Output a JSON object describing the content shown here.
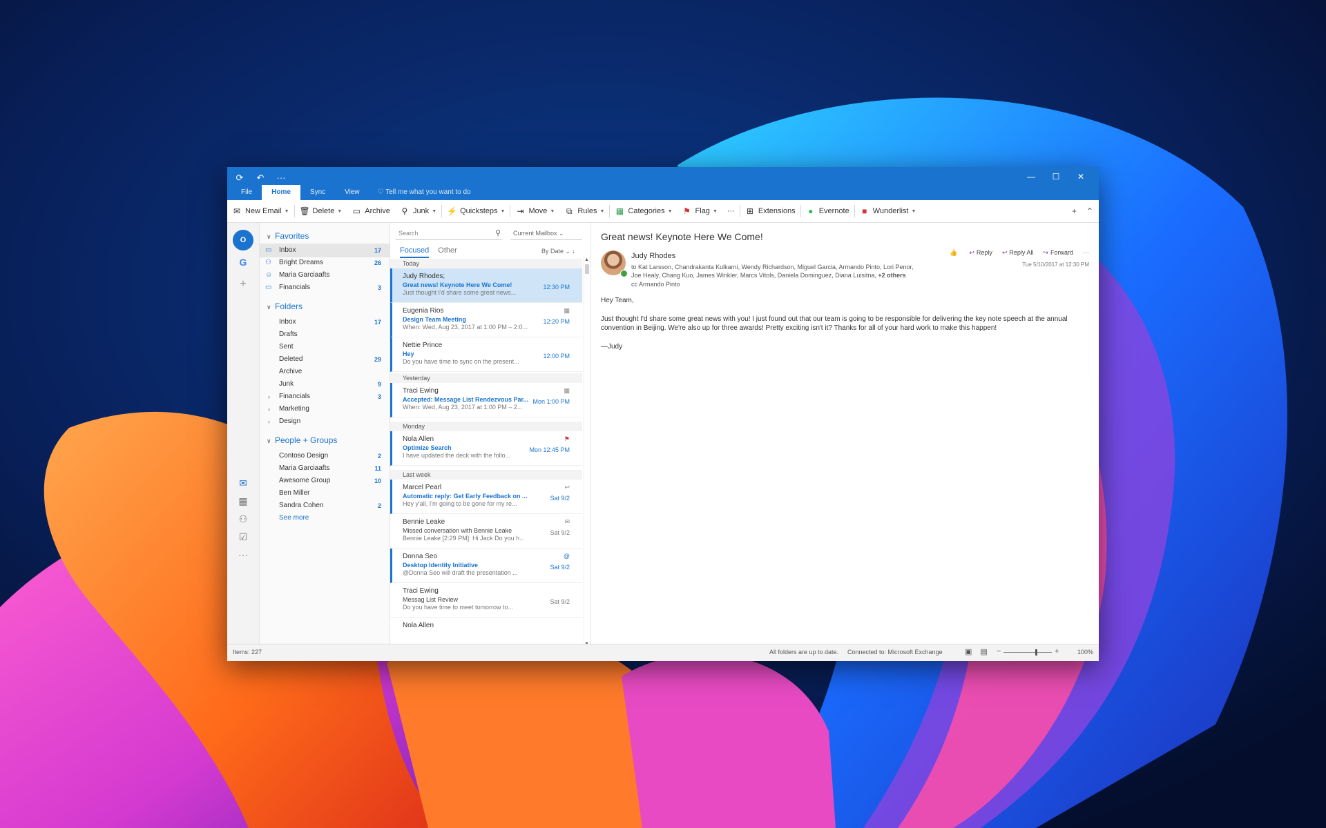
{
  "titlebar": {
    "icons": [
      "sync-icon",
      "undo-icon",
      "more-icon"
    ],
    "minimize": "—",
    "maximize": "☐",
    "close": "✕"
  },
  "tabs": [
    {
      "label": "File"
    },
    {
      "label": "Home"
    },
    {
      "label": "Sync"
    },
    {
      "label": "View"
    }
  ],
  "tellme": "Tell me what you want to do",
  "ribbon": {
    "new_email": "New Email",
    "delete": "Delete",
    "archive": "Archive",
    "junk": "Junk",
    "quicksteps": "Quicksteps",
    "move": "Move",
    "rules": "Rules",
    "categories": "Categories",
    "flag": "Flag",
    "more": "···",
    "extensions": "Extensions",
    "evernote": "Evernote",
    "wunderlist": "Wunderlist"
  },
  "favorites": {
    "title": "Favorites",
    "items": [
      {
        "label": "Inbox",
        "count": "17"
      },
      {
        "label": "Bright Dreams",
        "count": "26"
      },
      {
        "label": "Maria Garciaafts",
        "count": ""
      },
      {
        "label": "Financials",
        "count": "3"
      }
    ]
  },
  "folders": {
    "title": "Folders",
    "items": [
      {
        "label": "Inbox",
        "count": "17"
      },
      {
        "label": "Drafts",
        "count": ""
      },
      {
        "label": "Sent",
        "count": ""
      },
      {
        "label": "Deleted",
        "count": "29"
      },
      {
        "label": "Archive",
        "count": ""
      },
      {
        "label": "Junk",
        "count": "9"
      },
      {
        "label": "Financials",
        "count": "3"
      },
      {
        "label": "Marketing",
        "count": ""
      },
      {
        "label": "Design",
        "count": ""
      }
    ]
  },
  "people_groups": {
    "title": "People + Groups",
    "items": [
      {
        "label": "Contoso Design",
        "count": "2"
      },
      {
        "label": "Maria Garciaafts",
        "count": "11"
      },
      {
        "label": "Awesome Group",
        "count": "10"
      },
      {
        "label": "Ben Miller",
        "count": ""
      },
      {
        "label": "Sandra Cohen",
        "count": "2"
      }
    ],
    "see_more": "See more"
  },
  "msglist": {
    "search_placeholder": "Search",
    "mailbox": "Current Mailbox",
    "focused": "Focused",
    "other": "Other",
    "sort": "By Date",
    "groups": [
      "Today",
      "Yesterday",
      "Monday",
      "Last week"
    ],
    "messages": [
      {
        "from": "Judy Rhodes;",
        "subject": "Great news! Keynote Here We Come!",
        "preview": "Just thought I'd share some great news...",
        "time": "12:30 PM"
      },
      {
        "from": "Eugenia Rios",
        "subject": "Design Team Meeting",
        "preview": "When: Wed, Aug 23, 2017 at 1:00 PM – 2:0...",
        "time": "12:20 PM"
      },
      {
        "from": "Nettie Prince",
        "subject": "Hey",
        "preview": "Do you have time to sync on the present...",
        "time": "12:00 PM"
      },
      {
        "from": "Traci Ewing",
        "subject": "Accepted: Message List Rendezvous Par...",
        "preview": "When: Wed, Aug 23, 2017 at 1:00 PM – 2...",
        "time": "Mon 1:00 PM"
      },
      {
        "from": "Nola Allen",
        "subject": "Optimize Search",
        "preview": "I have updated the deck with the follo...",
        "time": "Mon 12:45 PM"
      },
      {
        "from": "Marcel Pearl",
        "subject": "Automatic reply: Get Early Feedback on ...",
        "preview": "Hey y'all, I'm going to be gone for my re...",
        "time": "Sat 9/2"
      },
      {
        "from": "Bennie Leake",
        "subject": "Missed conversation with Bennie Leake",
        "preview": "Bennie Leake [2:29 PM]: Hi Jack Do you h...",
        "time": "Sat 9/2"
      },
      {
        "from": "Donna Seo",
        "subject": "Desktop Identity Initiative",
        "preview": "@Donna Seo will draft the presentation ...",
        "time": "Sat 9/2"
      },
      {
        "from": "Traci Ewing",
        "subject": "Messag List Review",
        "preview": "Do you have time to meet tomorrow to...",
        "time": "Sat 9/2"
      },
      {
        "from": "Nola Allen",
        "subject": "",
        "preview": "",
        "time": ""
      }
    ]
  },
  "reading": {
    "subject": "Great news! Keynote Here We Come!",
    "from": "Judy Rhodes",
    "to": "to Kat Larsson, Chandrakanta Kulkarni, Wendy Richardson, Miguel Garcia, Armando Pinto, Lori Penor, Joe Healy, Chang Kuo, James Winkler, Marcs Vitols, Daniela Dominguez, Diana Luisitna,",
    "others": "+2 others",
    "cc": "cc Armando Pinto",
    "date": "Tue 5/10/2017 at 12:30 PM",
    "reply": "Reply",
    "reply_all": "Reply All",
    "forward": "Forward",
    "greeting": "Hey Team,",
    "body": "Just thought I'd share some great news with you! I just found out that our team is going to be responsible for delivering the key note speech at the annual convention in Beijing. We're also up for three awards! Pretty exciting isn't it? Thanks for all of your hard work to make this happen!",
    "signoff": "—Judy"
  },
  "status": {
    "items": "Items: 227",
    "sync": "All folders are up to date.",
    "connection": "Connected to: Microsoft Exchange",
    "zoom": "100%",
    "zoom_level": 1.0
  },
  "colors": {
    "accent": "#1a73cf",
    "selected": "#cfe4f7",
    "wall_dark": "#0a1a4a"
  }
}
